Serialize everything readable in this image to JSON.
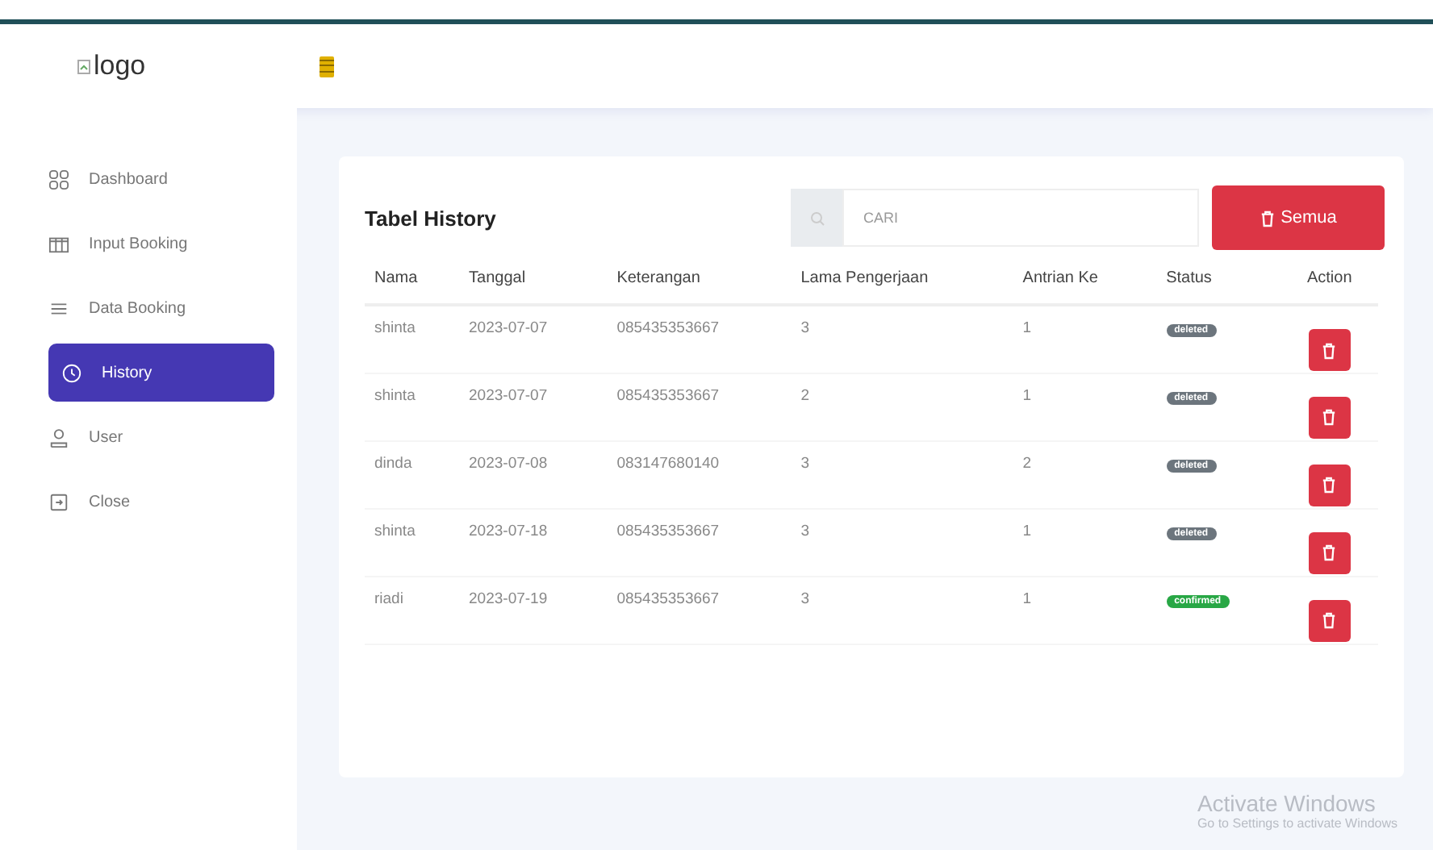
{
  "header": {
    "logo_alt": "logo"
  },
  "sidebar": {
    "items": [
      {
        "label": "Dashboard",
        "kind": "grid",
        "selected": false
      },
      {
        "label": "Input Booking",
        "kind": "columns",
        "selected": false
      },
      {
        "label": "Data Booking",
        "kind": "list",
        "selected": false
      },
      {
        "label": "History",
        "kind": "clock",
        "selected": true
      },
      {
        "label": "User",
        "kind": "user",
        "selected": false
      },
      {
        "label": "Close",
        "kind": "exit",
        "selected": false
      }
    ]
  },
  "card": {
    "title": "Tabel History",
    "search": {
      "placeholder": "CARI"
    },
    "button": "Semua",
    "table": {
      "columns": [
        "Nama",
        "Tanggal",
        "Keterangan",
        "Lama Pengerjaan",
        "Antrian Ke",
        "Status",
        "Action"
      ],
      "rows": [
        {
          "cells": [
            "shinta",
            "2023-07-07",
            "085435353667",
            "3",
            "1"
          ],
          "status": {
            "label": "deleted",
            "color": "#6c757d"
          }
        },
        {
          "cells": [
            "shinta",
            "2023-07-07",
            "085435353667",
            "2",
            "1"
          ],
          "status": {
            "label": "deleted",
            "color": "#6c757d"
          }
        },
        {
          "cells": [
            "dinda",
            "2023-07-08",
            "083147680140",
            "3",
            "2"
          ],
          "status": {
            "label": "deleted",
            "color": "#6c757d"
          }
        },
        {
          "cells": [
            "shinta",
            "2023-07-18",
            "085435353667",
            "3",
            "1"
          ],
          "status": {
            "label": "deleted",
            "color": "#6c757d"
          }
        },
        {
          "cells": [
            "riadi",
            "2023-07-19",
            "085435353667",
            "3",
            "1"
          ],
          "status": {
            "label": "confirmed",
            "color": "#28a745"
          }
        }
      ]
    }
  },
  "os_notice": {
    "title": "Activate Windows",
    "subtitle": "Go to Settings to activate Windows"
  }
}
